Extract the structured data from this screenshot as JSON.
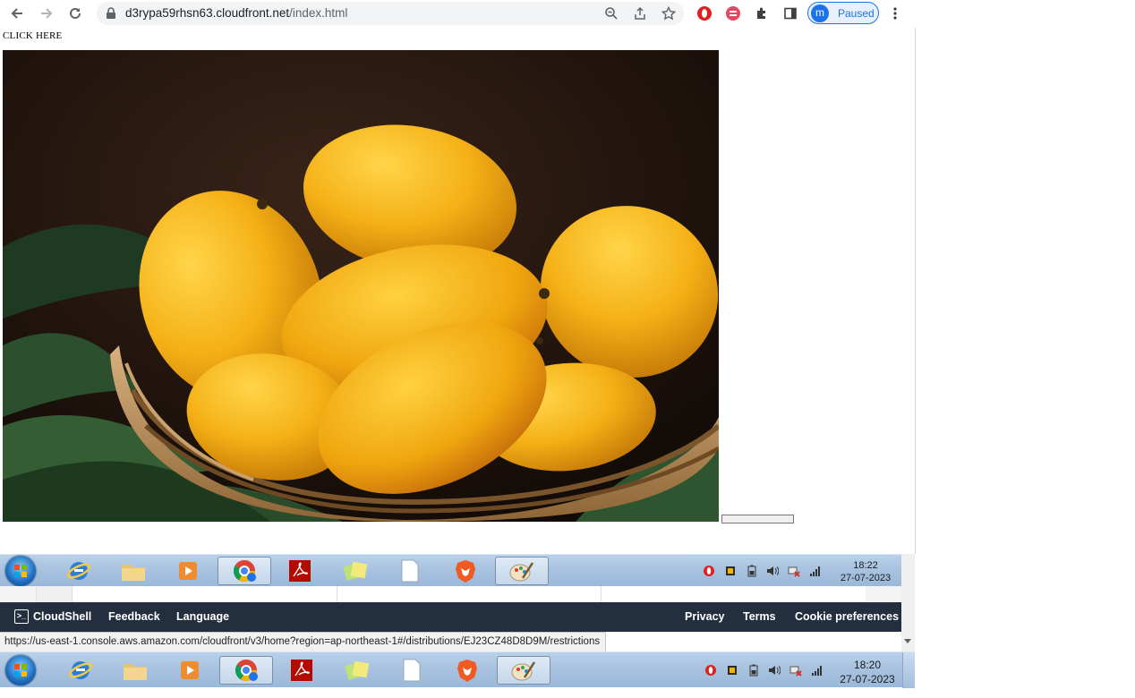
{
  "browser": {
    "url_host": "d3rypa59rhsn63.cloudfront.net",
    "url_path": "/index.html",
    "profile_initial": "m",
    "profile_status": "Paused"
  },
  "page": {
    "link_text": "CLICK HERE",
    "photo_subject": "mangoes-in-wicker-basket"
  },
  "taskbar_top": {
    "time": "18:22",
    "date": "27-07-2023",
    "pinned": [
      "internet-explorer",
      "file-explorer",
      "media-player",
      "chrome",
      "acrobat-reader",
      "sticky-notes",
      "notepad-file",
      "brave",
      "paint"
    ],
    "active_apps": [
      "chrome",
      "paint"
    ]
  },
  "aws_footer": {
    "cloudshell": "CloudShell",
    "feedback": "Feedback",
    "language": "Language",
    "privacy": "Privacy",
    "terms": "Terms",
    "cookie_preferences": "Cookie preferences"
  },
  "status_bar": {
    "hover_url": "https://us-east-1.console.aws.amazon.com/cloudfront/v3/home?region=ap-northeast-1#/distributions/EJ23CZ48D8D9M/restrictions"
  },
  "taskbar_bottom": {
    "time": "18:20",
    "date": "27-07-2023"
  },
  "colors": {
    "aws_footer_bg": "#232f3e",
    "chrome_profile_accent": "#1a73e8",
    "taskbar_blue": "#a7c2df"
  }
}
